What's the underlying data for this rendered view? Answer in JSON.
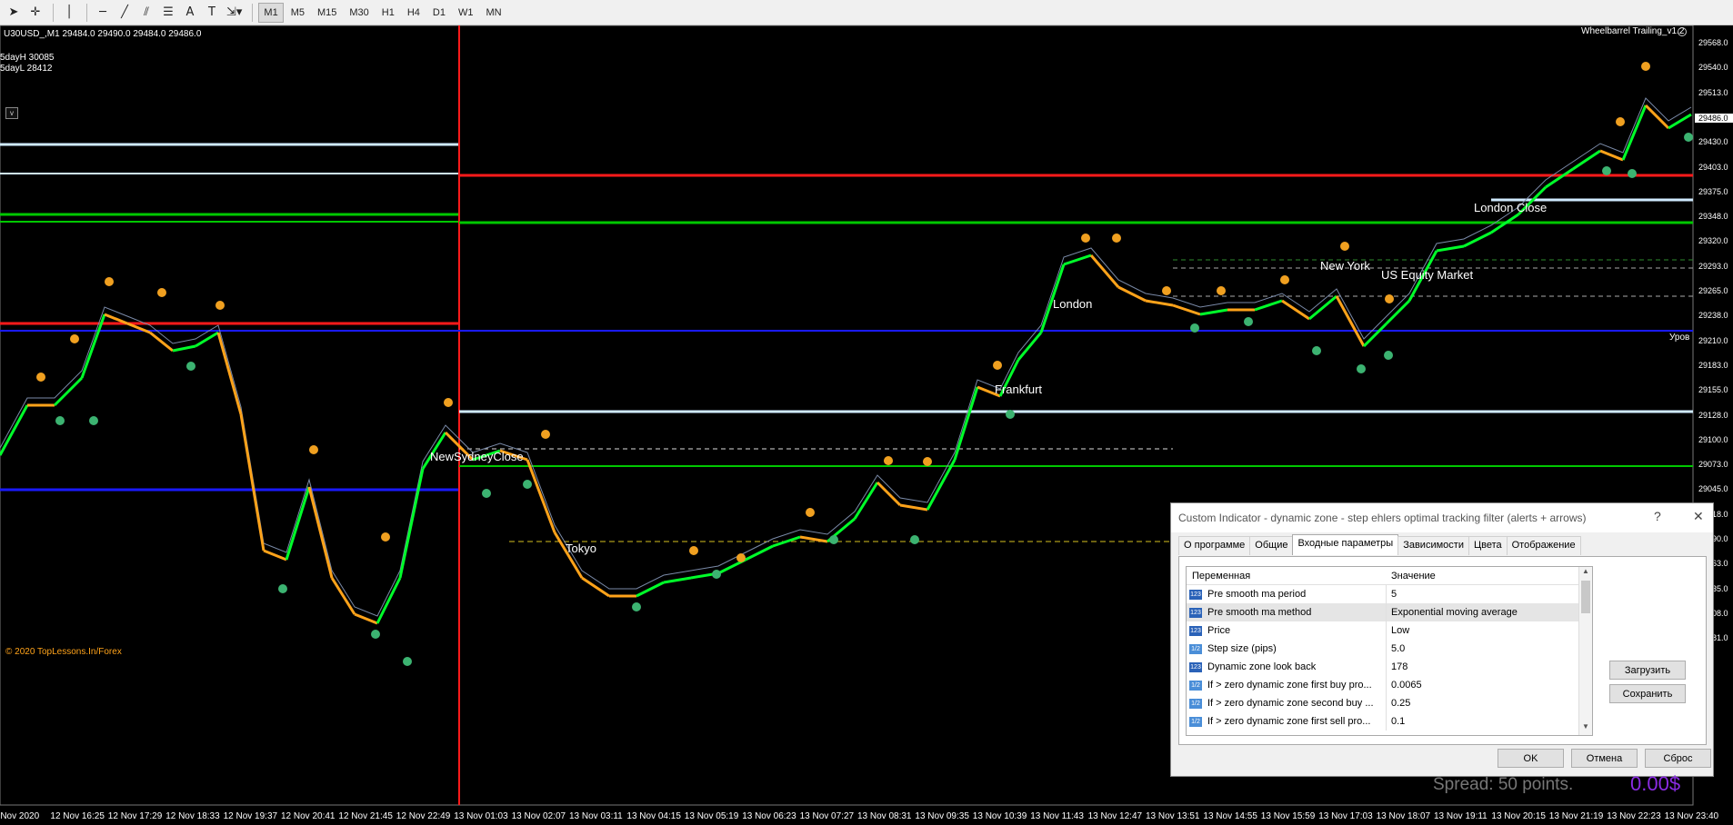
{
  "toolbar": {
    "timeframes": [
      "M1",
      "M5",
      "M15",
      "M30",
      "H1",
      "H4",
      "D1",
      "W1",
      "MN"
    ],
    "active_timeframe": "M1"
  },
  "chart": {
    "symbol_info": "U30USD_,M1  29484.0 29490.0 29484.0 29486.0",
    "sday_high": "5dayH 30085",
    "sday_low": "5dayL 28412",
    "indicator_name": "Wheelbarrel Trailing_v1.2",
    "copyright": "© 2020 TopLessons.In/Forex",
    "level_label": "Уров",
    "current_price": "29486.0",
    "price_labels": [
      "29568.0",
      "29540.0",
      "29513.0",
      "29458.0",
      "29430.0",
      "29403.0",
      "29375.0",
      "29348.0",
      "29320.0",
      "29293.0",
      "29265.0",
      "29238.0",
      "29210.0",
      "29183.0",
      "29155.0",
      "29128.0",
      "29100.0",
      "29073.0",
      "29045.0",
      "29018.0",
      "28990.0",
      "28963.0",
      "28935.0",
      "28908.0",
      "28881.0"
    ],
    "time_labels": [
      "2 Nov 2020",
      "12 Nov 16:25",
      "12 Nov 17:29",
      "12 Nov 18:33",
      "12 Nov 19:37",
      "12 Nov 20:41",
      "12 Nov 21:45",
      "12 Nov 22:49",
      "13 Nov 01:03",
      "13 Nov 02:07",
      "13 Nov 03:11",
      "13 Nov 04:15",
      "13 Nov 05:19",
      "13 Nov 06:23",
      "13 Nov 07:27",
      "13 Nov 08:31",
      "13 Nov 09:35",
      "13 Nov 10:39",
      "13 Nov 11:43",
      "13 Nov 12:47",
      "13 Nov 13:51",
      "13 Nov 14:55",
      "13 Nov 15:59",
      "13 Nov 17:03",
      "13 Nov 18:07",
      "13 Nov 19:11",
      "13 Nov 20:15",
      "13 Nov 21:19",
      "13 Nov 22:23",
      "13 Nov 23:40"
    ],
    "sessions": {
      "newyork_close": "NewSydneyClose",
      "tokyo": "Tokyo",
      "frankfurt": "Frankfurt",
      "london": "London",
      "new_york": "New York",
      "us_equity": "US Equity Market",
      "london_close": "London Close"
    },
    "colors": {
      "bull": "#00ff2a",
      "bear": "#ffa31a",
      "resistance": "#ff1a1a",
      "support": "#00c800",
      "pivot": "#1a1aff",
      "range": "#cfeaff"
    }
  },
  "dialog": {
    "title": "Custom Indicator - dynamic zone - step ehlers optimal tracking  filter (alerts + arrows)",
    "help": "?",
    "close": "✕",
    "tabs": [
      "О программе",
      "Общие",
      "Входные параметры",
      "Зависимости",
      "Цвета",
      "Отображение"
    ],
    "active_tab": "Входные параметры",
    "col_variable": "Переменная",
    "col_value": "Значение",
    "rows": [
      {
        "type": "123",
        "name": "Pre smooth ma period",
        "value": "5"
      },
      {
        "type": "123",
        "name": "Pre smooth ma method",
        "value": "Exponential moving average"
      },
      {
        "type": "123",
        "name": "Price",
        "value": "Low"
      },
      {
        "type": "1/2",
        "name": "Step size (pips)",
        "value": "5.0"
      },
      {
        "type": "123",
        "name": "Dynamic zone look back",
        "value": "178"
      },
      {
        "type": "1/2",
        "name": "If > zero dynamic zone first buy pro...",
        "value": "0.0065"
      },
      {
        "type": "1/2",
        "name": "If > zero dynamic zone second buy ...",
        "value": "0.25"
      },
      {
        "type": "1/2",
        "name": "If > zero dynamic zone first sell pro...",
        "value": "0.1"
      }
    ],
    "btn_load": "Загрузить",
    "btn_save": "Сохранить",
    "btn_ok": "OK",
    "btn_cancel": "Отмена",
    "btn_reset": "Сброс"
  },
  "status": {
    "spread": "Spread: 50 points.",
    "profit": "0.00$"
  }
}
